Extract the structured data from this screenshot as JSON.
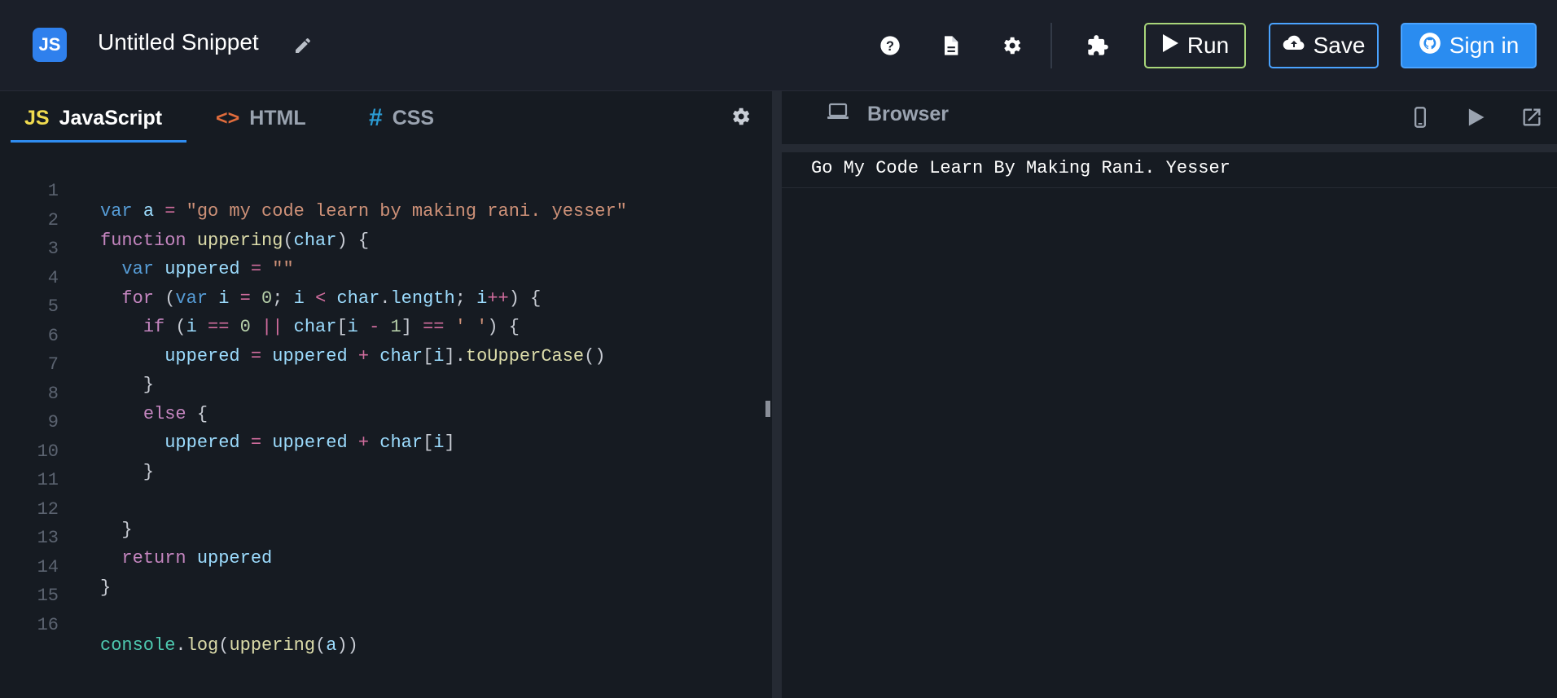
{
  "header": {
    "logo_text": "JS",
    "snippet_title": "Untitled Snippet",
    "run_label": "Run",
    "save_label": "Save",
    "signin_label": "Sign in",
    "icons": [
      "pencil-icon",
      "help-icon",
      "document-icon",
      "gear-icon",
      "puzzle-icon"
    ]
  },
  "editor": {
    "tabs": [
      {
        "badge": "JS",
        "label": "JavaScript",
        "active": true
      },
      {
        "badge": "<>",
        "label": "HTML",
        "active": false
      },
      {
        "badge": "#",
        "label": "CSS",
        "active": false
      }
    ],
    "line_numbers": [
      "1",
      "2",
      "3",
      "4",
      "5",
      "6",
      "7",
      "8",
      "9",
      "10",
      "11",
      "12",
      "13",
      "14",
      "15",
      "16"
    ],
    "code_lines": [
      "var a = \"go my code learn by making rani. yesser\"",
      "function uppering(char) {",
      "  var uppered = \"\"",
      "  for (var i = 0; i < char.length; i++) {",
      "    if (i == 0 || char[i - 1] == ' ') {",
      "      uppered = uppered + char[i].toUpperCase()",
      "    }",
      "    else {",
      "      uppered = uppered + char[i]",
      "    }",
      "",
      "  }",
      "  return uppered",
      "}",
      "",
      "console.log(uppering(a))"
    ]
  },
  "browser": {
    "tab_label": "Browser",
    "output": "Go My Code Learn By Making Rani. Yesser",
    "icons": [
      "laptop-icon",
      "mobile-icon",
      "play-icon",
      "external-link-icon"
    ]
  },
  "colors": {
    "background": "#161b22",
    "topbar": "#1b1f29",
    "run_border": "#a9d67a",
    "save_border": "#4aa3ff",
    "signin_bg": "#2a8cf0",
    "js_badge": "#f0db4f",
    "html_badge": "#e06c3c",
    "css_badge": "#2b9bd3"
  }
}
